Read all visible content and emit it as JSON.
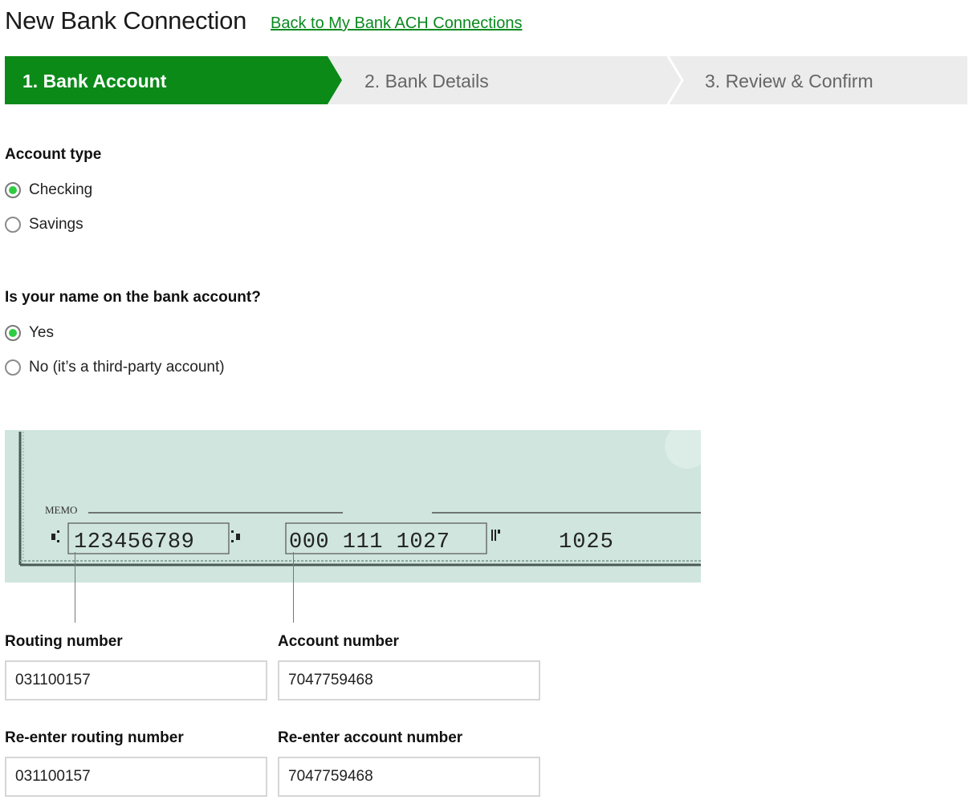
{
  "header": {
    "title": "New Bank Connection",
    "back_link": "Back to My Bank ACH Connections"
  },
  "stepper": {
    "steps": [
      {
        "label": "1. Bank Account",
        "active": true
      },
      {
        "label": "2. Bank Details",
        "active": false
      },
      {
        "label": "3. Review & Confirm",
        "active": false
      }
    ]
  },
  "account_type": {
    "label": "Account type",
    "options": [
      {
        "label": "Checking",
        "checked": true
      },
      {
        "label": "Savings",
        "checked": false
      }
    ]
  },
  "name_on_account": {
    "label": "Is your name on the bank account?",
    "options": [
      {
        "label": "Yes",
        "checked": true
      },
      {
        "label": "No (it’s a third-party account)",
        "checked": false
      }
    ]
  },
  "check_image": {
    "memo": "MEMO",
    "routing_digits": "123456789",
    "account_digits": "000 111 1027",
    "check_number": "1025"
  },
  "form": {
    "routing_label": "Routing number",
    "routing_value": "031100157",
    "account_label": "Account number",
    "account_value": "7047759468",
    "reenter_routing_label": "Re-enter routing number",
    "reenter_routing_value": "031100157",
    "reenter_account_label": "Re-enter account number",
    "reenter_account_value": "7047759468"
  },
  "colors": {
    "brand_green": "#0a8a1f",
    "active_step": "#0b8a18",
    "inactive_step": "#ececec",
    "radio_selected": "#2ecc40",
    "check_background": "#d1e6e0"
  }
}
